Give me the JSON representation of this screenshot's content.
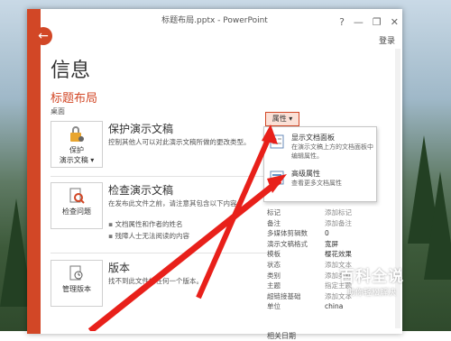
{
  "window": {
    "title": "标题布局.pptx - PowerPoint",
    "help": "?",
    "minimize": "—",
    "restore": "❐",
    "close": "✕",
    "signin": "登录"
  },
  "backstage": {
    "back_icon": "back-arrow-icon",
    "page_title": "信息",
    "doc_title": "标题布局",
    "doc_location": "桌面"
  },
  "protect": {
    "button_line1": "保护",
    "button_line2": "演示文稿 ▾",
    "title": "保护演示文稿",
    "desc": "控制其他人可以对此演示文稿所做的更改类型。"
  },
  "inspect": {
    "button_label": "检查问题",
    "title": "检查演示文稿",
    "desc": "在发布此文件之前，请注意其包含以下内容:",
    "bullets": [
      "文档属性和作者的姓名",
      "残障人士无法阅读的内容"
    ]
  },
  "versions": {
    "button_label": "管理版本",
    "title": "版本",
    "desc": "找不到此文件的任何一个版本。"
  },
  "properties": {
    "button_label": "属性 ▾",
    "menu": [
      {
        "title": "显示文档面板",
        "desc": "在演示文稿上方的文档面板中编辑属性。",
        "icon": "document-panel-icon"
      },
      {
        "title": "高级属性",
        "desc": "查看更多文档属性",
        "icon": "advanced-properties-icon"
      }
    ],
    "rows": [
      {
        "name": "标记",
        "value": "添加标记"
      },
      {
        "name": "备注",
        "value": "添加备注"
      },
      {
        "name": "多媒体剪辑数",
        "value": "0"
      },
      {
        "name": "演示文稿格式",
        "value": "宽屏"
      },
      {
        "name": "模板",
        "value": "樱花效果"
      },
      {
        "name": "状态",
        "value": "添加文本"
      },
      {
        "name": "类别",
        "value": "添加类别"
      },
      {
        "name": "主题",
        "value": "指定主题"
      },
      {
        "name": "超链接基础",
        "value": "添加文本"
      },
      {
        "name": "单位",
        "value": "china"
      }
    ],
    "related_dates": "相关日期"
  },
  "watermark": {
    "big": "百科全说",
    "small": "助你轻松解决"
  },
  "colors": {
    "accent": "#d24726",
    "arrow": "#e8201a"
  }
}
